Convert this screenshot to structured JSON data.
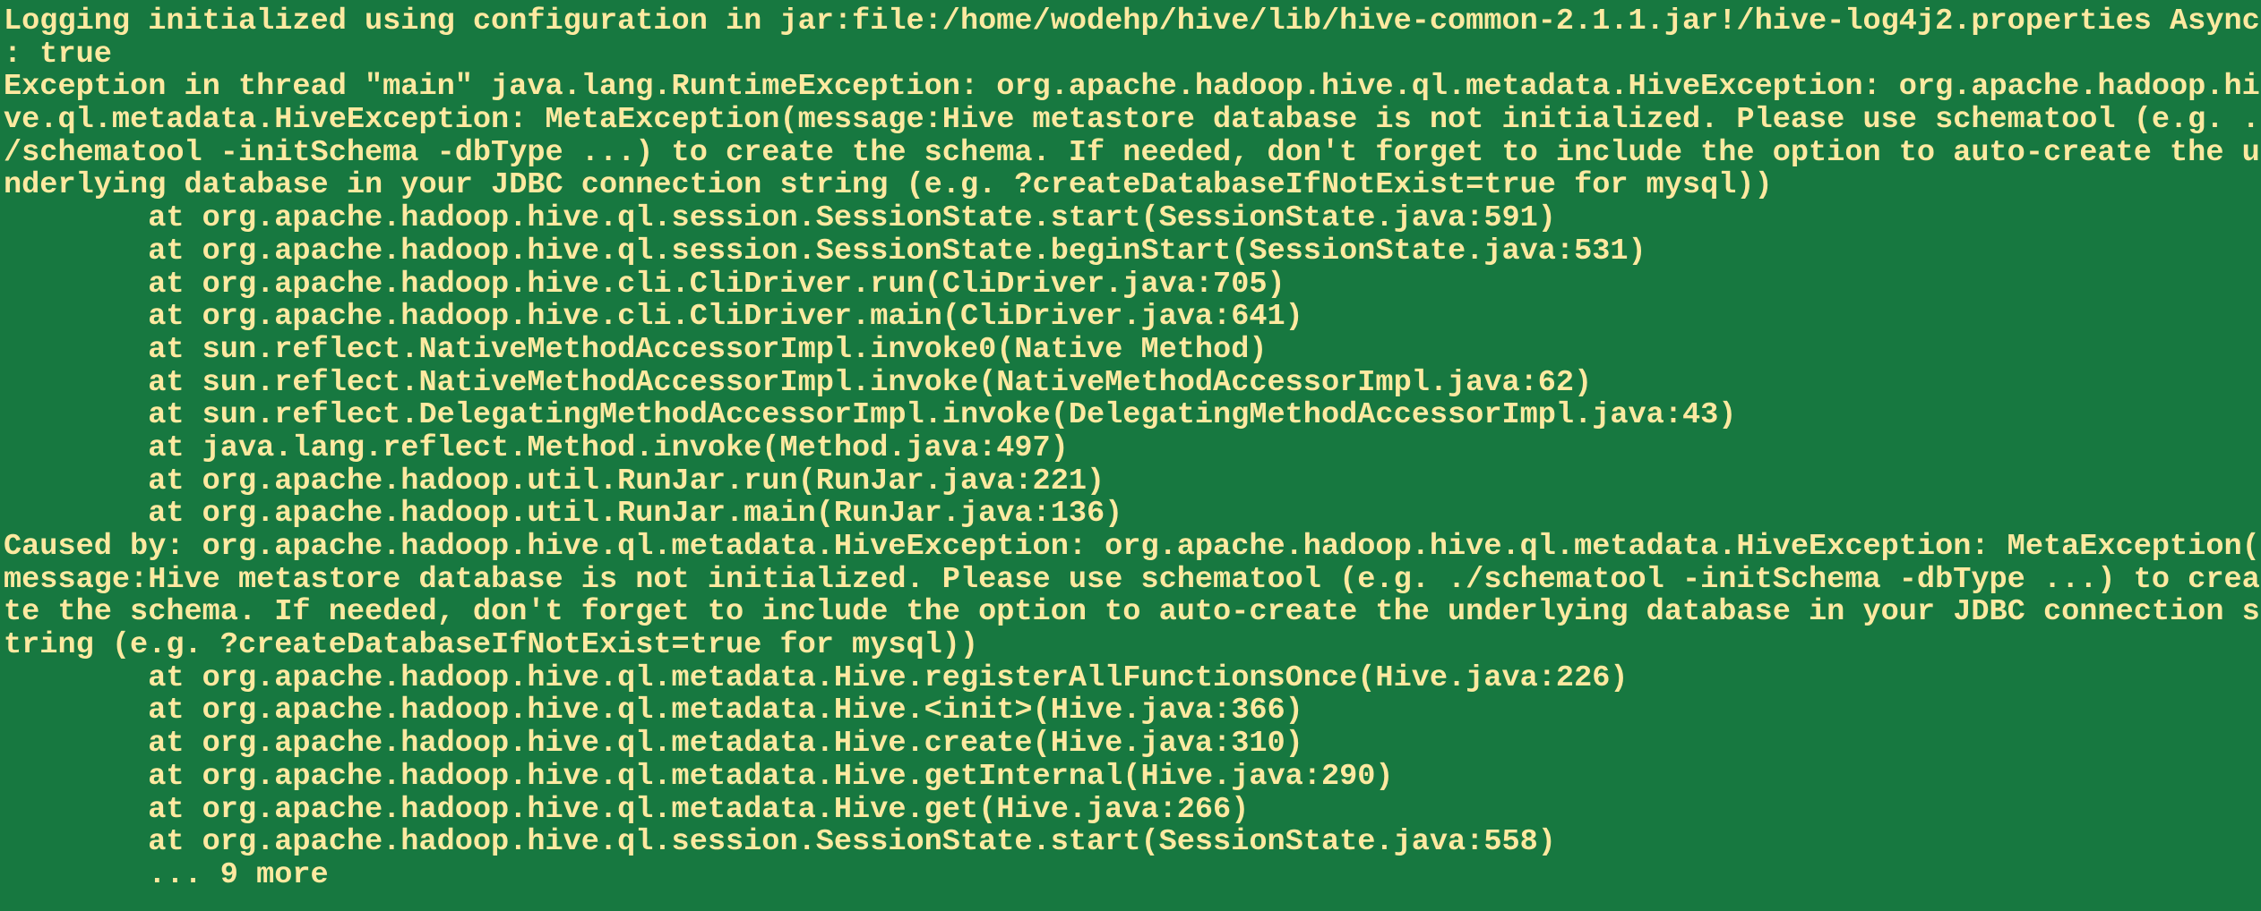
{
  "terminal": {
    "background_color": "#177840",
    "text_color": "#fde9a0",
    "lines": [
      "Logging initialized using configuration in jar:file:/home/wodehp/hive/lib/hive-common-2.1.1.jar!/hive-log4j2.properties Async",
      ": true",
      "Exception in thread \"main\" java.lang.RuntimeException: org.apache.hadoop.hive.ql.metadata.HiveException: org.apache.hadoop.hi",
      "ve.ql.metadata.HiveException: MetaException(message:Hive metastore database is not initialized. Please use schematool (e.g. .",
      "/schematool -initSchema -dbType ...) to create the schema. If needed, don't forget to include the option to auto-create the u",
      "nderlying database in your JDBC connection string (e.g. ?createDatabaseIfNotExist=true for mysql))",
      "        at org.apache.hadoop.hive.ql.session.SessionState.start(SessionState.java:591)",
      "        at org.apache.hadoop.hive.ql.session.SessionState.beginStart(SessionState.java:531)",
      "        at org.apache.hadoop.hive.cli.CliDriver.run(CliDriver.java:705)",
      "        at org.apache.hadoop.hive.cli.CliDriver.main(CliDriver.java:641)",
      "        at sun.reflect.NativeMethodAccessorImpl.invoke0(Native Method)",
      "        at sun.reflect.NativeMethodAccessorImpl.invoke(NativeMethodAccessorImpl.java:62)",
      "        at sun.reflect.DelegatingMethodAccessorImpl.invoke(DelegatingMethodAccessorImpl.java:43)",
      "        at java.lang.reflect.Method.invoke(Method.java:497)",
      "        at org.apache.hadoop.util.RunJar.run(RunJar.java:221)",
      "        at org.apache.hadoop.util.RunJar.main(RunJar.java:136)",
      "Caused by: org.apache.hadoop.hive.ql.metadata.HiveException: org.apache.hadoop.hive.ql.metadata.HiveException: MetaException(",
      "message:Hive metastore database is not initialized. Please use schematool (e.g. ./schematool -initSchema -dbType ...) to crea",
      "te the schema. If needed, don't forget to include the option to auto-create the underlying database in your JDBC connection s",
      "tring (e.g. ?createDatabaseIfNotExist=true for mysql))",
      "        at org.apache.hadoop.hive.ql.metadata.Hive.registerAllFunctionsOnce(Hive.java:226)",
      "        at org.apache.hadoop.hive.ql.metadata.Hive.<init>(Hive.java:366)",
      "        at org.apache.hadoop.hive.ql.metadata.Hive.create(Hive.java:310)",
      "        at org.apache.hadoop.hive.ql.metadata.Hive.getInternal(Hive.java:290)",
      "        at org.apache.hadoop.hive.ql.metadata.Hive.get(Hive.java:266)",
      "        at org.apache.hadoop.hive.ql.session.SessionState.start(SessionState.java:558)",
      "        ... 9 more"
    ]
  }
}
